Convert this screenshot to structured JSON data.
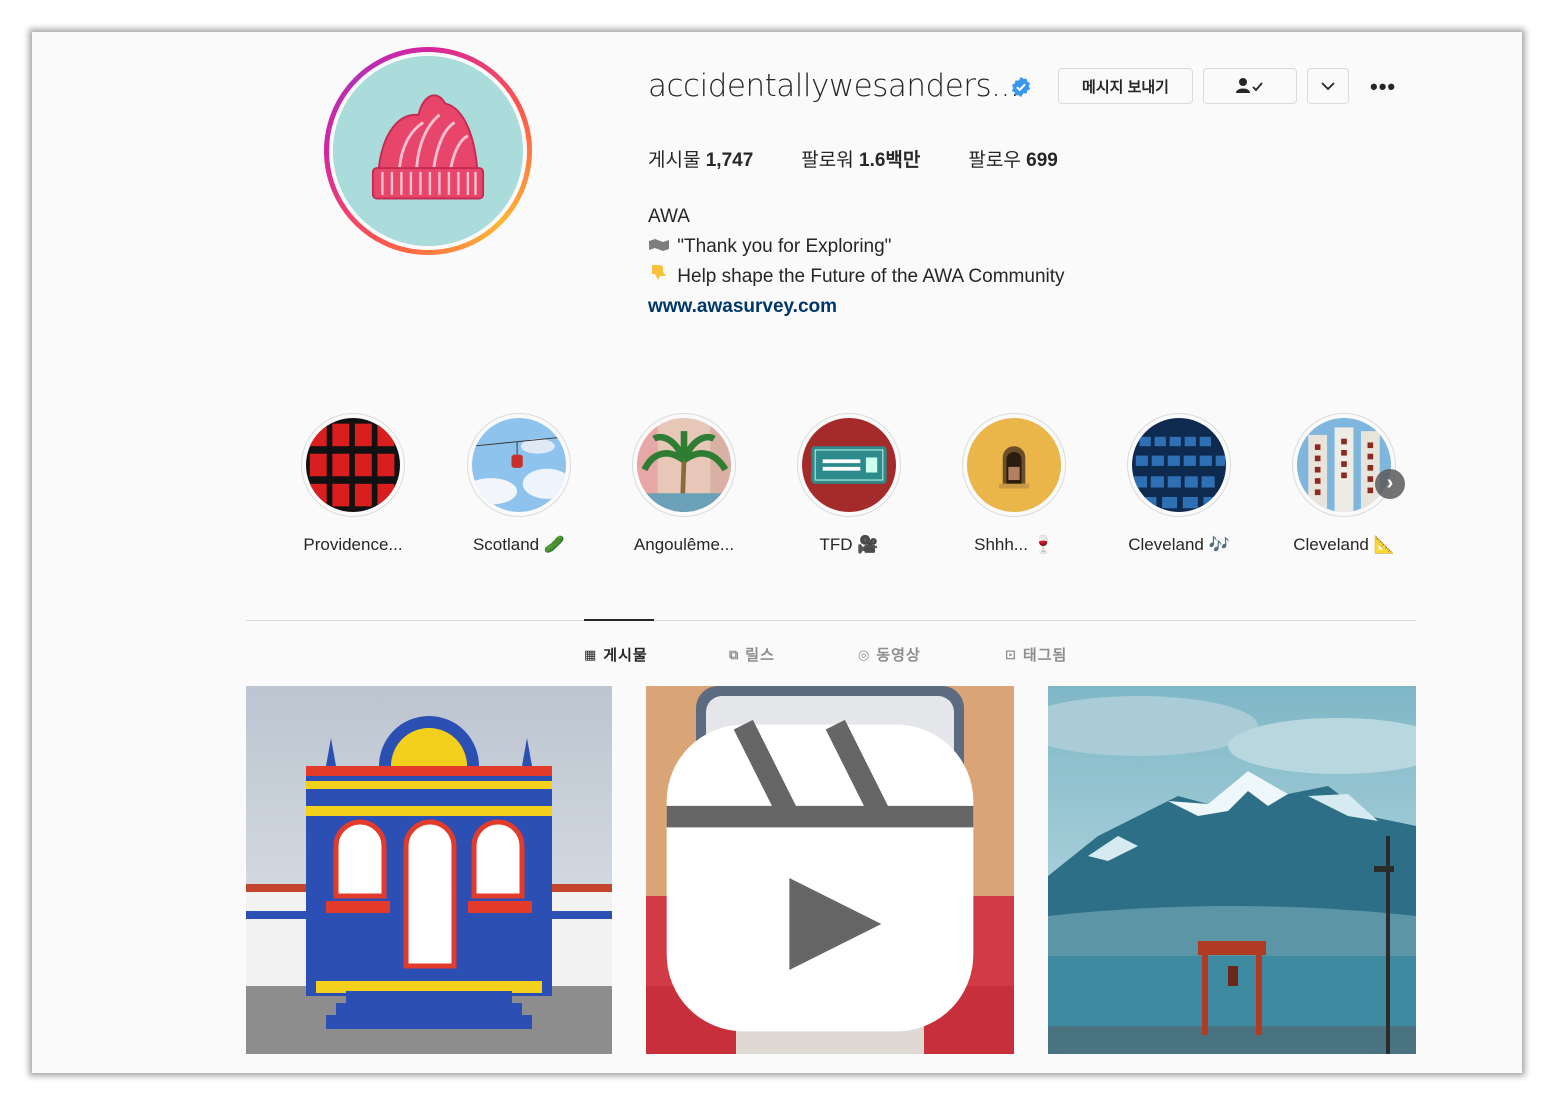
{
  "profile": {
    "username": "accidentallywesanders...",
    "display_name": "AWA",
    "bio_line1": "\"Thank you for Exploring\"",
    "bio_line2": "Help shape the Future of the AWA Community",
    "website": "www.awasurvey.com",
    "bio_line1_icon": "world-map-icon",
    "bio_line2_icon": "pointing-hand-icon"
  },
  "actions": {
    "message_label": "메시지 보내기",
    "follow_icon": "person-check-icon",
    "dropdown_icon": "chevron-down-icon",
    "more_label": "•••"
  },
  "stats": {
    "posts_label": "게시물",
    "posts_value": "1,747",
    "followers_label": "팔로워",
    "followers_value": "1.6백만",
    "following_label": "팔로우",
    "following_value": "699"
  },
  "highlights": [
    {
      "label": "Providence..."
    },
    {
      "label": "Scotland 🥒"
    },
    {
      "label": "Angoulême..."
    },
    {
      "label": "TFD 🎥"
    },
    {
      "label": "Shhh... 🍷"
    },
    {
      "label": "Cleveland 🎶"
    },
    {
      "label": "Cleveland 📐"
    }
  ],
  "highlight_next": "›",
  "tabs": [
    {
      "label": "게시물",
      "icon": "grid-icon",
      "active": true
    },
    {
      "label": "릴스",
      "icon": "reels-icon",
      "active": false
    },
    {
      "label": "동영상",
      "icon": "video-icon",
      "active": false
    },
    {
      "label": "태그됨",
      "icon": "tagged-icon",
      "active": false
    }
  ],
  "tab_icons": [
    "▦",
    "⧉",
    "◎",
    "⊡"
  ],
  "colors": {
    "accent_link": "#00376b",
    "verified_blue": "#3897f0",
    "avatar_bg": "#a9dcdb",
    "hat_pink": "#e8456b"
  }
}
